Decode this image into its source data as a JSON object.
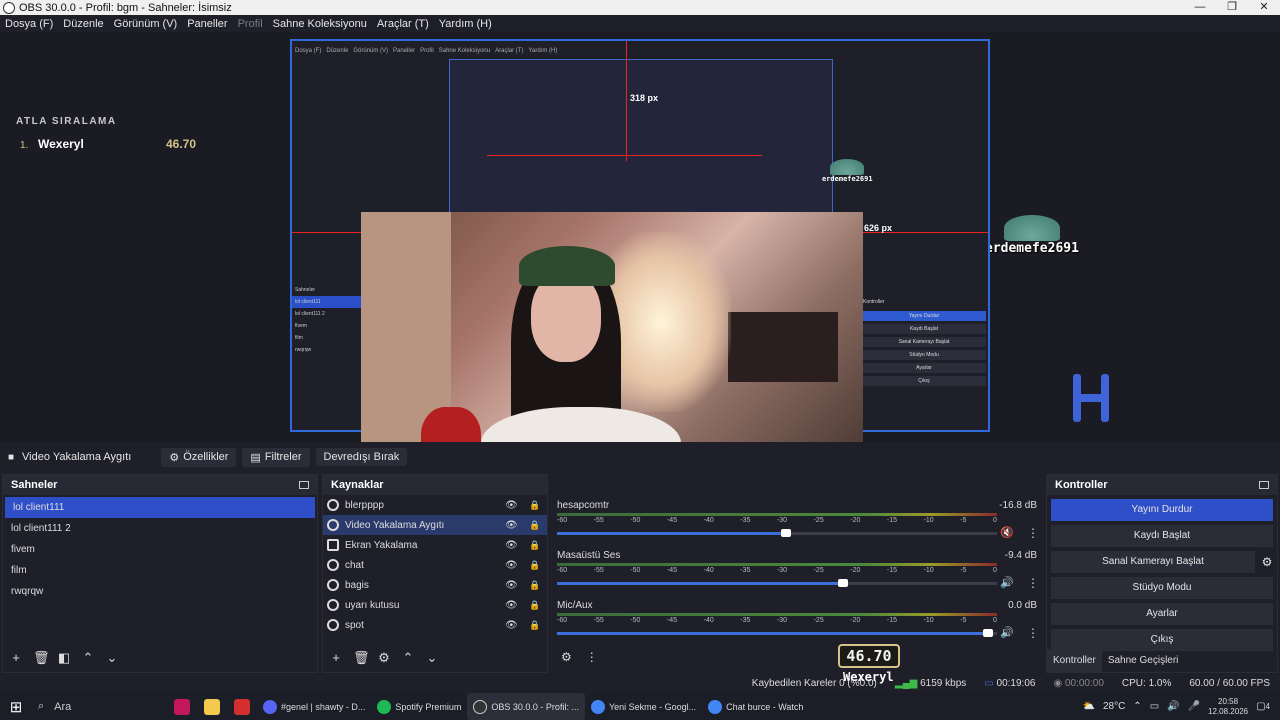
{
  "window": {
    "title": "OBS 30.0.0 - Profil: bgm - Sahneler: İsimsiz"
  },
  "menubar": {
    "items": [
      "Dosya (F)",
      "Düzenle",
      "Görünüm (V)",
      "Paneller",
      "Profil",
      "Sahne Koleksiyonu",
      "Araçlar (T)",
      "Yardım (H)"
    ]
  },
  "preview": {
    "leaderboard_header": "ATLA SIRALAMA",
    "leaderboard_rank": "1.",
    "leaderboard_name": "Wexeryl",
    "leaderboard_value": "46.70",
    "player_name": "erdemefe2691",
    "measure_top": "318 px",
    "measure_right": "626 px"
  },
  "source_toolbar": {
    "source_name": "Video Yakalama Aygıtı",
    "properties": "Özellikler",
    "filters": "Filtreler",
    "deactivate": "Devredışı Bırak"
  },
  "scenes": {
    "title": "Sahneler",
    "items": [
      "lol client111",
      "lol client111 2",
      "fivem",
      "film",
      "rwqrqw"
    ],
    "selected": "lol client111"
  },
  "sources": {
    "title": "Kaynaklar",
    "items": [
      "blerpppp",
      "Video Yakalama Aygıtı",
      "Ekran Yakalama",
      "chat",
      "bagis",
      "uyarı kutusu",
      "spot"
    ],
    "selected": "Video Yakalama Aygıtı"
  },
  "mixer": {
    "tick_labels": [
      "-60",
      "-55",
      "-50",
      "-45",
      "-40",
      "-35",
      "-30",
      "-25",
      "-20",
      "-15",
      "-10",
      "-5",
      "0"
    ],
    "channels": [
      {
        "name": "hesapcomtr",
        "db": "-16.8 dB",
        "level": 0.52,
        "muted": true
      },
      {
        "name": "Masaüstü Ses",
        "db": "-9.4 dB",
        "level": 0.65,
        "muted": false
      },
      {
        "name": "Mic/Aux",
        "db": "0.0 dB",
        "level": 0.98,
        "muted": false
      }
    ]
  },
  "controls": {
    "title": "Kontroller",
    "stop_stream": "Yayını Durdur",
    "start_recording": "Kaydı Başlat",
    "start_virtual_cam": "Sanal Kamerayı Başlat",
    "studio_mode": "Stüdyo Modu",
    "settings": "Ayarlar",
    "exit": "Çıkış",
    "tab_controls": "Kontroller",
    "tab_transitions": "Sahne Geçişleri"
  },
  "statusbar": {
    "dropped_frames": "Kaybedilen Kareler 0 (%0.0)",
    "bitrate": "6159 kbps",
    "stream_time": "00:19:06",
    "record_time": "00:00:00",
    "cpu": "CPU: 1.0%",
    "fps": "60.00 / 60.00 FPS"
  },
  "score_overlay": {
    "value": "46.70",
    "name": "Wexeryl"
  },
  "taskbar": {
    "search_placeholder": "Ara",
    "apps": [
      {
        "label": "#genel | shawty - D...",
        "color": "#5865f2"
      },
      {
        "label": "Spotify Premium",
        "color": "#1db954"
      },
      {
        "label": "OBS 30.0.0 - Profil: ...",
        "color": "#333333"
      },
      {
        "label": "Yeni Sekme - Googl...",
        "color": "#4285f4"
      },
      {
        "label": "Chat burce - Watch",
        "color": "#4285f4"
      }
    ],
    "weather": "28°C",
    "time": "20:58",
    "date": "12.08.2026",
    "notifications": "4"
  }
}
